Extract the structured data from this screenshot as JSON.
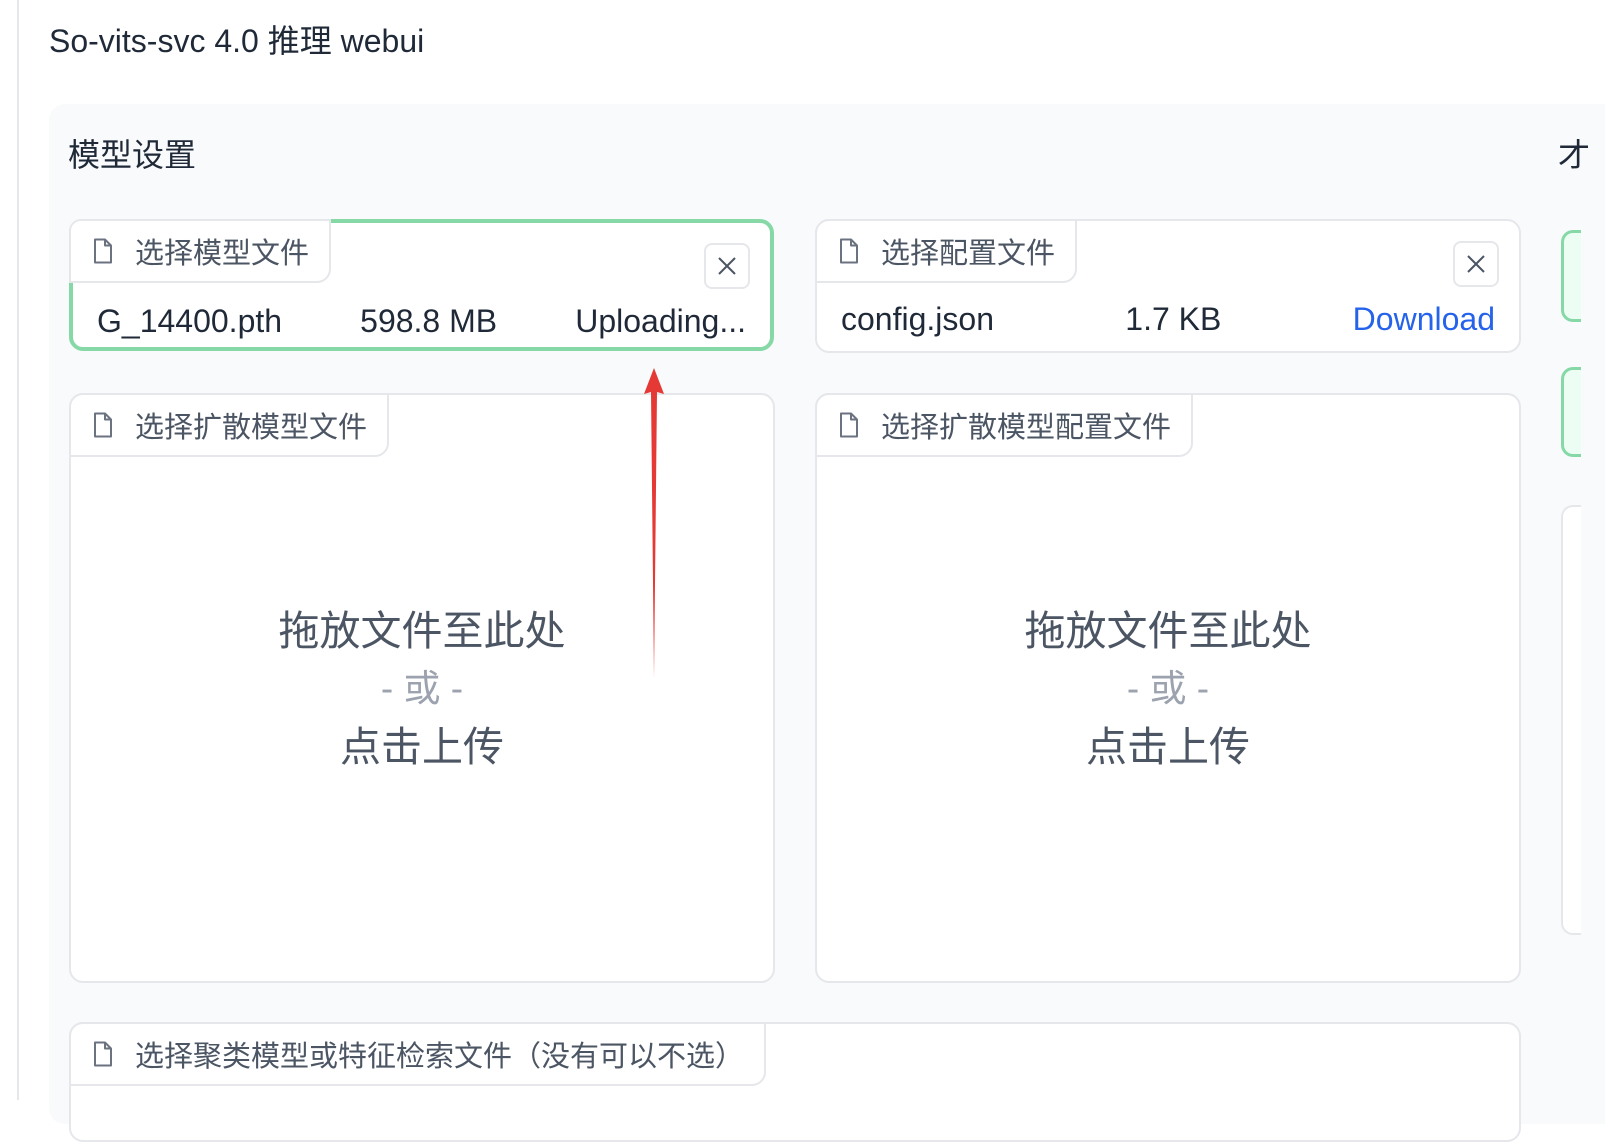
{
  "header": {
    "title": "So-vits-svc 4.0 推理 webui"
  },
  "model_settings": {
    "title": "模型设置",
    "model_file": {
      "label": "选择模型文件",
      "file_name": "G_14400.pth",
      "file_size": "598.8 MB",
      "status": "Uploading..."
    },
    "config_file": {
      "label": "选择配置文件",
      "file_name": "config.json",
      "file_size": "1.7 KB",
      "action": "Download"
    },
    "diffusion_model": {
      "label": "选择扩散模型文件",
      "drop_text": "拖放文件至此处",
      "or_text": "- 或 -",
      "click_text": "点击上传"
    },
    "diffusion_config": {
      "label": "选择扩散模型配置文件",
      "drop_text": "拖放文件至此处",
      "or_text": "- 或 -",
      "click_text": "点击上传"
    },
    "cluster_model": {
      "label": "选择聚类模型或特征检索文件（没有可以不选）"
    }
  },
  "right_panel": {
    "title_fragment": "才"
  },
  "colors": {
    "active_border": "#86d9a6",
    "link": "#2563eb",
    "annotation_arrow": "#e53935"
  },
  "icons": [
    "file-icon",
    "close-icon"
  ]
}
